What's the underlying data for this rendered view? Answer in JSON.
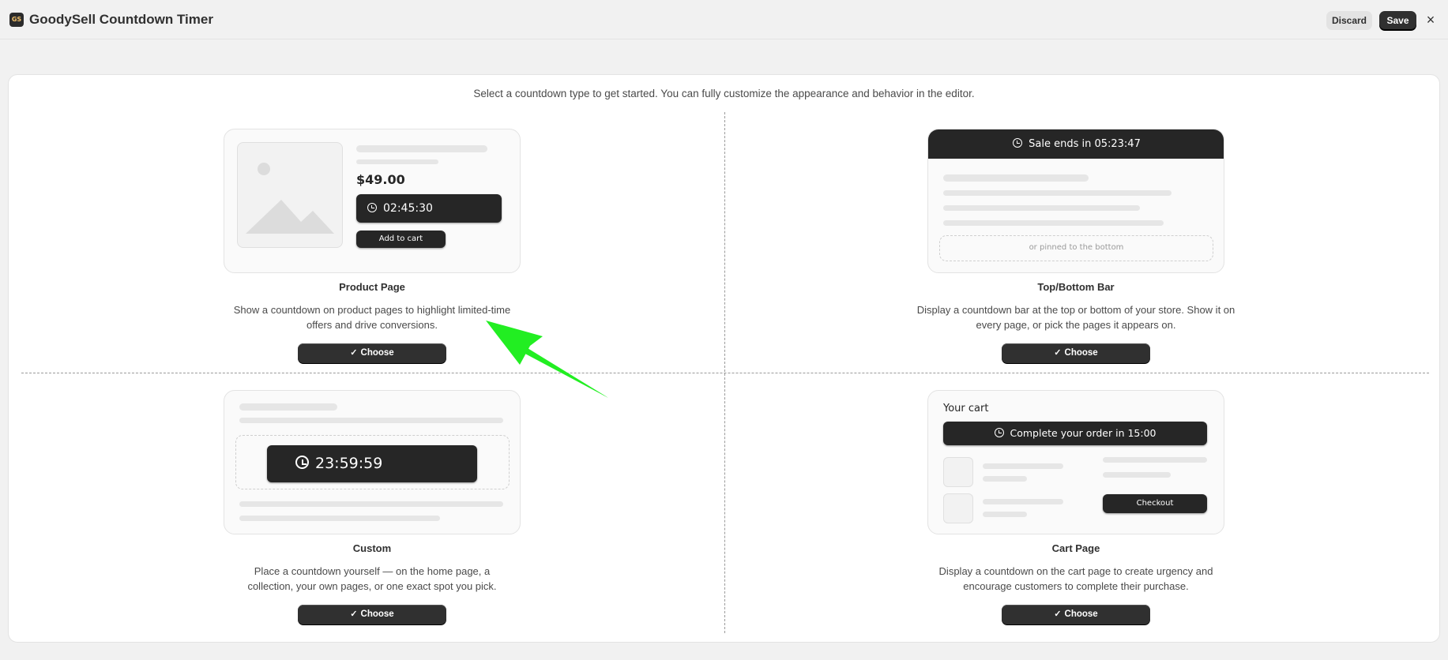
{
  "app": {
    "logo": "GS",
    "title": "GoodySell Countdown Timer",
    "discard_label": "Discard",
    "save_label": "Save",
    "close_icon": "×"
  },
  "intro": "Select a countdown type to get started. You can fully customize the appearance and behavior in the editor.",
  "options": [
    {
      "title": "Product Page",
      "description": "Show a countdown on product pages to highlight limited-time offers and drive conversions.",
      "choose_label": "Choose",
      "preview": {
        "price": "$49.00",
        "timer": "02:45:30",
        "button": "Add to cart"
      }
    },
    {
      "title": "Top/Bottom Bar",
      "description": "Display a countdown bar at the top or bottom of your store. Show it on every page, or pick the pages it appears on.",
      "choose_label": "Choose",
      "preview": {
        "bar_text": "Sale ends in 05:23:47",
        "pinned_text": "or pinned to the bottom"
      }
    },
    {
      "title": "Custom",
      "description": "Place a countdown yourself — on the home page, a collection, your own pages, or one exact spot you pick.",
      "choose_label": "Choose",
      "preview": {
        "timer": "23:59:59"
      }
    },
    {
      "title": "Cart Page",
      "description": "Display a countdown on the cart page to create urgency and encourage customers to complete their purchase.",
      "choose_label": "Choose",
      "preview": {
        "heading": "Your cart",
        "timer_text": "Complete your order in 15:00",
        "checkout": "Checkout"
      }
    }
  ],
  "colors": {
    "accent_dark": "#303030",
    "annotation": "#22ee22"
  }
}
